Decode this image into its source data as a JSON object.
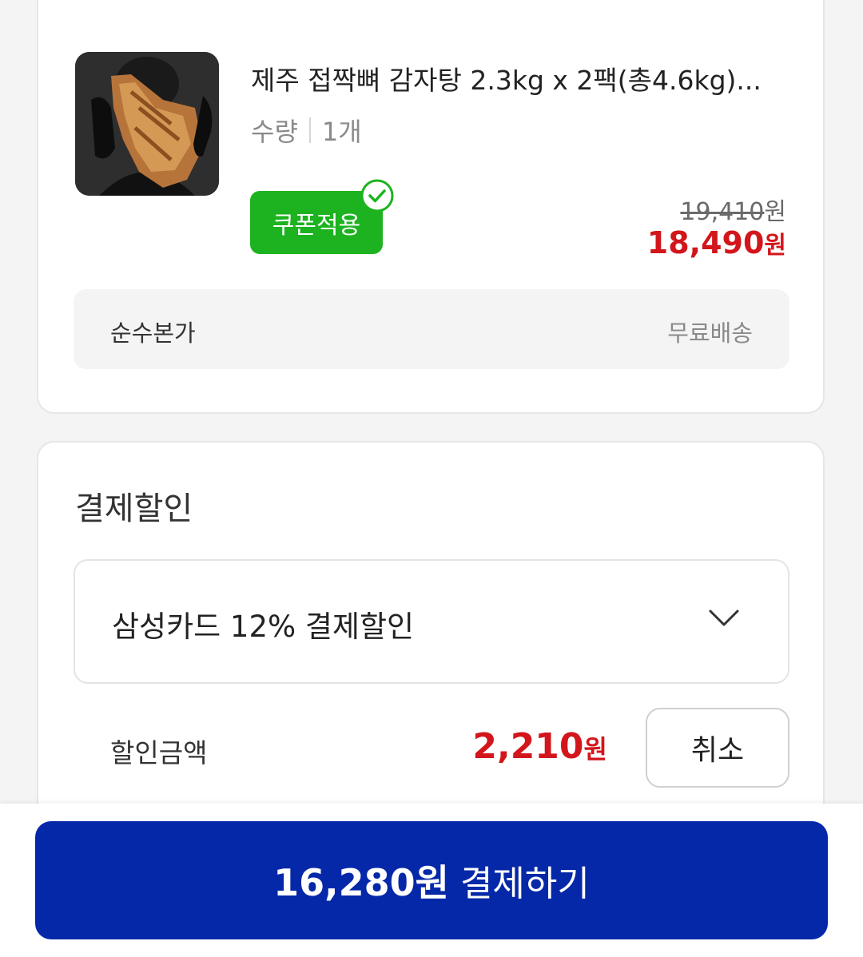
{
  "product": {
    "image_alt": "감자탕 상품 이미지",
    "title": "제주 접짝뼈 감자탕 2.3kg x 2팩(총4.6kg)...",
    "quantity_label": "수량",
    "quantity_value": "1개",
    "coupon_label": "쿠폰적용",
    "original_price": "19,410",
    "original_unit": "원",
    "sale_price": "18,490",
    "sale_unit": "원",
    "price_type_label": "순수본가",
    "shipping_label": "무료배송"
  },
  "payment_discount": {
    "title": "결제할인",
    "selected_option": "삼성카드 12% 결제할인",
    "amount_label": "할인금액",
    "amount": "2,210",
    "amount_unit": "원",
    "cancel_label": "취소"
  },
  "checkout": {
    "amount": "16,280원",
    "label": "결제하기"
  },
  "colors": {
    "accent_red": "#d2161b",
    "coupon_green": "#1db320",
    "pay_blue": "#0528a8"
  }
}
